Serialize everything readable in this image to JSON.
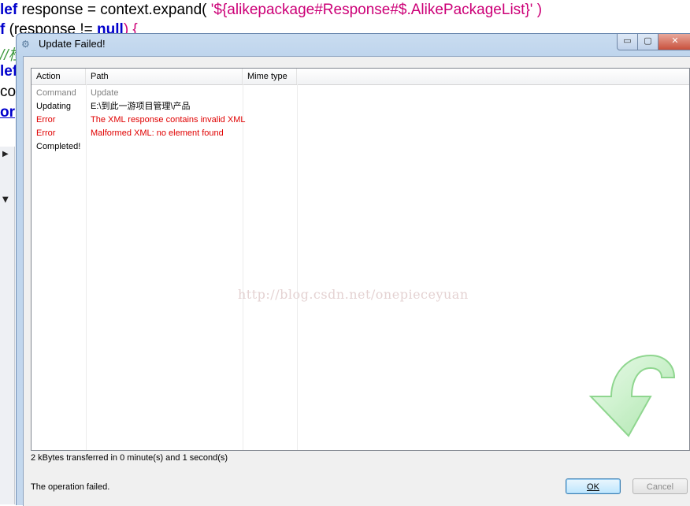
{
  "background_code": {
    "line1": {
      "kw": "lef",
      "rest": " response = context.expand(",
      "str": " '${alikepackage#Response#$.AlikePackageList}'",
      "close": " )"
    },
    "line2": {
      "kw": "f",
      "rest": " (response != ",
      "kw2": "null",
      "close": ") {"
    },
    "line3": {
      "comment": "//检"
    },
    "line4": {
      "kw": "lef"
    },
    "line5": {
      "text": "cou"
    },
    "line6": {
      "link": "or"
    }
  },
  "dialog": {
    "title": "Update Failed!",
    "window_buttons": {
      "minimize": "▭",
      "maximize": "▢",
      "close": "✕"
    },
    "columns": [
      "Action",
      "Path",
      "Mime type"
    ],
    "rows": [
      {
        "action": "Command",
        "path": "Update",
        "mime": "",
        "color": "#808080"
      },
      {
        "action": "Updating",
        "path": "E:\\到此一游项目管理\\产品",
        "mime": "",
        "color": "#000000"
      },
      {
        "action": "Error",
        "path": "The XML response contains invalid XML",
        "mime": "",
        "color": "#e00000"
      },
      {
        "action": "Error",
        "path": "Malformed XML: no element found",
        "mime": "",
        "color": "#e00000"
      },
      {
        "action": "Completed!",
        "path": "",
        "mime": "",
        "color": "#000000"
      }
    ],
    "watermark": "http://blog.csdn.net/onepieceyuan",
    "transfer_status": "2 kBytes transferred in 0 minute(s) and 1 second(s)",
    "operation_status": "The operation failed.",
    "ok_label": "OK",
    "cancel_label": "Cancel"
  },
  "icons": {
    "title": "gear-icon",
    "illustration": "green-curved-arrow-icon"
  },
  "colors": {
    "error": "#e00000",
    "muted": "#808080",
    "arrow": "#9ee29e"
  }
}
